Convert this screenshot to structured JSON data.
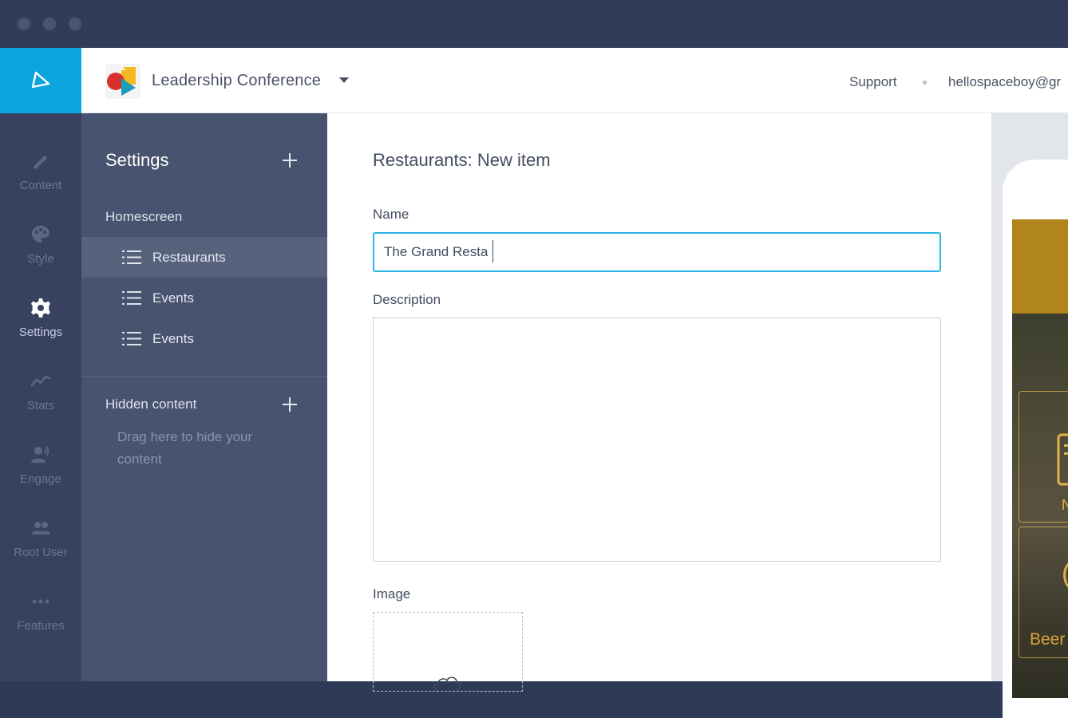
{
  "window": {
    "controls": [
      "close",
      "minimize",
      "zoom"
    ]
  },
  "header": {
    "logo_icon": "paper-plane-icon",
    "app_name": "Leadership Conference",
    "support_label": "Support",
    "account_email": "hellospaceboy@gr"
  },
  "rail": {
    "items": [
      {
        "label": "Content",
        "icon": "pencil-icon"
      },
      {
        "label": "Style",
        "icon": "palette-icon"
      },
      {
        "label": "Settings",
        "icon": "gear-icon",
        "active": true
      },
      {
        "label": "Stats",
        "icon": "chart-line-icon"
      },
      {
        "label": "Engage",
        "icon": "user-broadcast-icon"
      },
      {
        "label": "Root User",
        "icon": "users-icon"
      },
      {
        "label": "Features",
        "icon": "more-dots-icon"
      }
    ]
  },
  "panel": {
    "title": "Settings",
    "homescreen_label": "Homescreen",
    "items": [
      {
        "label": "Restaurants",
        "selected": true
      },
      {
        "label": "Events"
      },
      {
        "label": "Events"
      }
    ],
    "hidden_title": "Hidden content",
    "hidden_hint": "Drag here to hide your content"
  },
  "form": {
    "title": "Restaurants: New item",
    "name_label": "Name",
    "name_value": "The Grand Resta",
    "description_label": "Description",
    "description_value": "",
    "image_label": "Image"
  },
  "preview": {
    "visible_text": [
      "N",
      "(",
      "Beer"
    ]
  },
  "colors": {
    "brand": "#0da5df",
    "rail_bg": "#384260",
    "panel_bg": "#48536f",
    "selected_bg": "#57627d",
    "focus_border": "#2db4e4",
    "preview_accent": "#b0851c"
  }
}
